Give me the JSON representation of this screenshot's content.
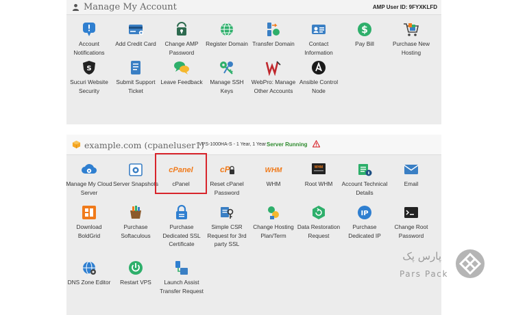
{
  "account": {
    "title": "Manage My Account",
    "amp_user_id": "AMP User ID: 9FYXKLFD",
    "items": [
      {
        "label": "Account Notifications",
        "icon": "notification-bubble-icon"
      },
      {
        "label": "Add Credit Card",
        "icon": "credit-card-icon"
      },
      {
        "label": "Change AMP Password",
        "icon": "lock-icon"
      },
      {
        "label": "Register Domain",
        "icon": "globe-icon"
      },
      {
        "label": "Transfer Domain",
        "icon": "transfer-domain-icon"
      },
      {
        "label": "Contact Information",
        "icon": "contact-card-icon"
      },
      {
        "label": "Pay Bill",
        "icon": "dollar-icon"
      },
      {
        "label": "Purchase New Hosting",
        "icon": "shopping-cart-icon"
      },
      {
        "label": "Sucuri Website Security",
        "icon": "shield-icon"
      },
      {
        "label": "Submit Support Ticket",
        "icon": "support-ticket-icon"
      },
      {
        "label": "Leave Feedback",
        "icon": "speech-bubbles-icon"
      },
      {
        "label": "Manage SSH Keys",
        "icon": "keys-icon"
      },
      {
        "label": "WebPro: Manage Other Accounts",
        "icon": "webpro-icon"
      },
      {
        "label": "Ansible Control Node",
        "icon": "ansible-icon"
      }
    ]
  },
  "server": {
    "title": "example.com (cpaneluser1)",
    "plan": "VPS-1000HA-S - 1 Year, 1 Year",
    "status": "Server Running",
    "items": [
      {
        "label": "Manage My Cloud Server",
        "icon": "cloud-server-icon"
      },
      {
        "label": "Server Snapshots",
        "icon": "camera-icon"
      },
      {
        "label": "cPanel",
        "icon": "cpanel-logo-icon"
      },
      {
        "label": "Reset cPanel Password",
        "icon": "cpanel-reset-icon"
      },
      {
        "label": "WHM",
        "icon": "whm-logo-icon"
      },
      {
        "label": "Root WHM",
        "icon": "root-whm-icon"
      },
      {
        "label": "Account Technical Details",
        "icon": "account-details-icon"
      },
      {
        "label": "Email",
        "icon": "envelope-icon"
      },
      {
        "label": "Download BoldGrid",
        "icon": "boldgrid-icon"
      },
      {
        "label": "Purchase Softaculous",
        "icon": "softaculous-icon"
      },
      {
        "label": "Purchase Dedicated SSL Certificate",
        "icon": "ssl-lock-icon"
      },
      {
        "label": "Simple CSR Request for 3rd party SSL",
        "icon": "csr-request-icon"
      },
      {
        "label": "Change Hosting Plan/Term",
        "icon": "hosting-plan-icon"
      },
      {
        "label": "Data Restoration Request",
        "icon": "data-restore-icon"
      },
      {
        "label": "Purchase Dedicated IP",
        "icon": "dedicated-ip-icon"
      },
      {
        "label": "Change Root Password",
        "icon": "terminal-icon"
      },
      {
        "label": "DNS Zone Editor",
        "icon": "dns-icon"
      },
      {
        "label": "Restart VPS",
        "icon": "power-icon"
      },
      {
        "label": "Launch Assist Transfer Request",
        "icon": "launch-assist-icon"
      }
    ],
    "cpanel_logo_text": "cPanel",
    "whm_logo_text": "WHM"
  },
  "watermark": {
    "persian": "پارس پک",
    "english": "Pars Pack"
  },
  "colors": {
    "highlight": "#d8232a",
    "status": "#2e8b2e",
    "blue": "#3a7fc4",
    "orange": "#f07a1a"
  }
}
